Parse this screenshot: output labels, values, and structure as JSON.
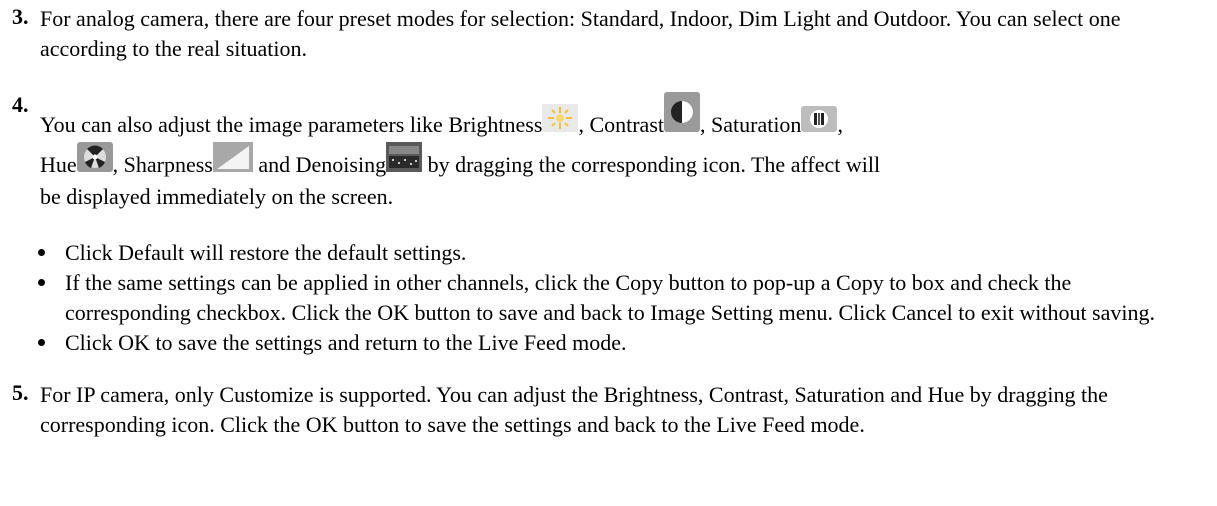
{
  "steps": {
    "s3": {
      "num": "3.",
      "text": "For analog camera, there are four preset modes for selection: Standard, Indoor, Dim Light and Outdoor. You can select one according to the real situation."
    },
    "s4": {
      "num": "4.",
      "t1": "You can also adjust the image parameters like Brightness",
      "t2": ", Contrast",
      "t3": ", Saturation",
      "t4": ",",
      "t5": "Hue",
      "t6": ", Sharpness",
      "t7": " and Denoising",
      "t8": " by dragging the corresponding icon. The affect will",
      "t9": "be displayed immediately on the screen."
    },
    "bullets": [
      "Click Default will restore the default settings.",
      "If the same settings can be applied in other channels, click the Copy button to pop-up a Copy to box and check the corresponding checkbox. Click the OK button to save and back to Image Setting menu. Click Cancel to exit without saving.",
      "Click OK to save the settings and return to the Live Feed mode."
    ],
    "s5": {
      "num": "5.",
      "text": "For IP camera, only Customize is supported. You can adjust the Brightness, Contrast, Saturation and Hue by dragging the corresponding icon. Click the OK button to save the settings and back to the Live Feed mode."
    }
  },
  "icons": [
    "brightness-icon",
    "contrast-icon",
    "saturation-icon",
    "hue-icon",
    "sharpness-icon",
    "denoising-icon"
  ]
}
